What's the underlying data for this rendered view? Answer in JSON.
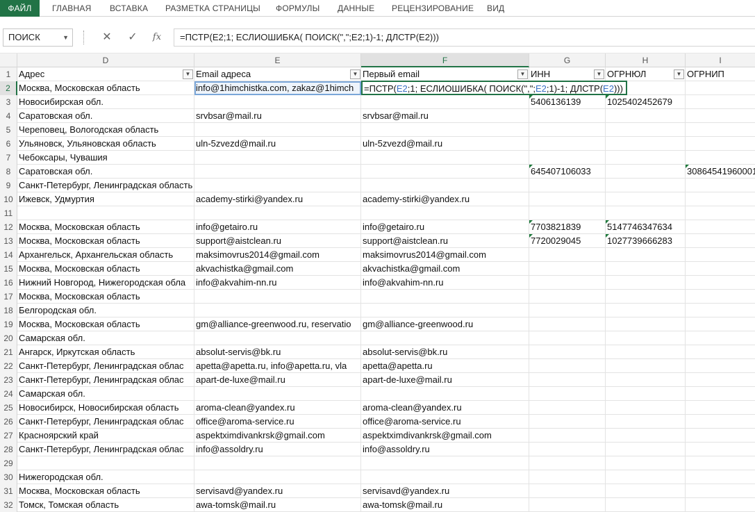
{
  "ribbon": {
    "tabs": [
      "ФАЙЛ",
      "ГЛАВНАЯ",
      "ВСТАВКА",
      "РАЗМЕТКА СТРАНИЦЫ",
      "ФОРМУЛЫ",
      "ДАННЫЕ",
      "РЕЦЕНЗИРОВАНИЕ",
      "ВИД"
    ]
  },
  "formula_bar": {
    "name_box": "ПОИСК",
    "cancel_icon": "✕",
    "enter_icon": "✓",
    "fx_label": "fx",
    "formula": "=ПСТР(E2;1; ЕСЛИОШИБКА( ПОИСК(\",\";E2;1)-1; ДЛСТР(E2)))"
  },
  "columns": [
    "D",
    "E",
    "F",
    "G",
    "H",
    "I"
  ],
  "header_row": {
    "row": "1",
    "d": "Адрес",
    "e": "Email адреса",
    "f": "Первый email",
    "g": "ИНН",
    "h": "ОГРНЮЛ",
    "i": "ОГРНИП"
  },
  "edit_cell": {
    "p1": "=ПСТР(",
    "r1": "E2",
    "p2": ";1; ЕСЛИОШИБКА( ПОИСК(\",\";",
    "r2": "E2",
    "p3": ";1)-1; ДЛСТР(",
    "r3": "E2",
    "p4": ")))"
  },
  "rows": [
    {
      "n": "2",
      "d": "Москва, Московская область",
      "e": "info@1himchistka.com, zakaz@1himch",
      "f": "",
      "g": "",
      "h": "",
      "i": ""
    },
    {
      "n": "3",
      "d": "Новосибирская обл.",
      "e": "",
      "f": "",
      "g": "5406136139",
      "h": "1025402452679",
      "i": ""
    },
    {
      "n": "4",
      "d": "Саратовская обл.",
      "e": "srvbsar@mail.ru",
      "f": "srvbsar@mail.ru",
      "g": "",
      "h": "",
      "i": ""
    },
    {
      "n": "5",
      "d": "Череповец, Вологодская область",
      "e": "",
      "f": "",
      "g": "",
      "h": "",
      "i": ""
    },
    {
      "n": "6",
      "d": "Ульяновск, Ульяновская область",
      "e": "uln-5zvezd@mail.ru",
      "f": "uln-5zvezd@mail.ru",
      "g": "",
      "h": "",
      "i": ""
    },
    {
      "n": "7",
      "d": "Чебоксары, Чувашия",
      "e": "",
      "f": "",
      "g": "",
      "h": "",
      "i": ""
    },
    {
      "n": "8",
      "d": "Саратовская обл.",
      "e": "",
      "f": "",
      "g": "645407106033",
      "h": "",
      "i": "30864541960001"
    },
    {
      "n": "9",
      "d": "Санкт-Петербург, Ленинградская область",
      "e": "",
      "f": "",
      "g": "",
      "h": "",
      "i": ""
    },
    {
      "n": "10",
      "d": "Ижевск, Удмуртия",
      "e": "academy-stirki@yandex.ru",
      "f": "academy-stirki@yandex.ru",
      "g": "",
      "h": "",
      "i": ""
    },
    {
      "n": "11",
      "d": "",
      "e": "",
      "f": "",
      "g": "",
      "h": "",
      "i": ""
    },
    {
      "n": "12",
      "d": "Москва, Московская область",
      "e": "info@getairo.ru",
      "f": "info@getairo.ru",
      "g": "7703821839",
      "h": "5147746347634",
      "i": ""
    },
    {
      "n": "13",
      "d": "Москва, Московская область",
      "e": "support@aistclean.ru",
      "f": "support@aistclean.ru",
      "g": "7720029045",
      "h": "1027739666283",
      "i": ""
    },
    {
      "n": "14",
      "d": "Архангельск, Архангельская область",
      "e": "maksimovrus2014@gmail.com",
      "f": "maksimovrus2014@gmail.com",
      "g": "",
      "h": "",
      "i": ""
    },
    {
      "n": "15",
      "d": "Москва, Московская область",
      "e": "akvachistka@gmail.com",
      "f": "akvachistka@gmail.com",
      "g": "",
      "h": "",
      "i": ""
    },
    {
      "n": "16",
      "d": "Нижний Новгород, Нижегородская обла",
      "e": "info@akvahim-nn.ru",
      "f": "info@akvahim-nn.ru",
      "g": "",
      "h": "",
      "i": ""
    },
    {
      "n": "17",
      "d": "Москва, Московская область",
      "e": "",
      "f": "",
      "g": "",
      "h": "",
      "i": ""
    },
    {
      "n": "18",
      "d": "Белгородская обл.",
      "e": "",
      "f": "",
      "g": "",
      "h": "",
      "i": ""
    },
    {
      "n": "19",
      "d": "Москва, Московская область",
      "e": "gm@alliance-greenwood.ru, reservatio",
      "f": "gm@alliance-greenwood.ru",
      "g": "",
      "h": "",
      "i": ""
    },
    {
      "n": "20",
      "d": "Самарская обл.",
      "e": "",
      "f": "",
      "g": "",
      "h": "",
      "i": ""
    },
    {
      "n": "21",
      "d": "Ангарск, Иркутская область",
      "e": "absolut-servis@bk.ru",
      "f": "absolut-servis@bk.ru",
      "g": "",
      "h": "",
      "i": ""
    },
    {
      "n": "22",
      "d": "Санкт-Петербург, Ленинградская облас",
      "e": "apetta@apetta.ru, info@apetta.ru, vla",
      "f": "apetta@apetta.ru",
      "g": "",
      "h": "",
      "i": ""
    },
    {
      "n": "23",
      "d": "Санкт-Петербург, Ленинградская облас",
      "e": "apart-de-luxe@mail.ru",
      "f": "apart-de-luxe@mail.ru",
      "g": "",
      "h": "",
      "i": ""
    },
    {
      "n": "24",
      "d": "Самарская обл.",
      "e": "",
      "f": "",
      "g": "",
      "h": "",
      "i": ""
    },
    {
      "n": "25",
      "d": "Новосибирск, Новосибирская область",
      "e": "aroma-clean@yandex.ru",
      "f": "aroma-clean@yandex.ru",
      "g": "",
      "h": "",
      "i": ""
    },
    {
      "n": "26",
      "d": "Санкт-Петербург, Ленинградская облас",
      "e": "office@aroma-service.ru",
      "f": "office@aroma-service.ru",
      "g": "",
      "h": "",
      "i": ""
    },
    {
      "n": "27",
      "d": "Красноярский край",
      "e": "aspektximdivankrsk@gmail.com",
      "f": "aspektximdivankrsk@gmail.com",
      "g": "",
      "h": "",
      "i": ""
    },
    {
      "n": "28",
      "d": "Санкт-Петербург, Ленинградская облас",
      "e": "info@assoldry.ru",
      "f": "info@assoldry.ru",
      "g": "",
      "h": "",
      "i": ""
    },
    {
      "n": "29",
      "d": "",
      "e": "",
      "f": "",
      "g": "",
      "h": "",
      "i": ""
    },
    {
      "n": "30",
      "d": "Нижегородская обл.",
      "e": "",
      "f": "",
      "g": "",
      "h": "",
      "i": ""
    },
    {
      "n": "31",
      "d": "Москва, Московская область",
      "e": "servisavd@yandex.ru",
      "f": "servisavd@yandex.ru",
      "g": "",
      "h": "",
      "i": ""
    },
    {
      "n": "32",
      "d": "Томск, Томская область",
      "e": "awa-tomsk@mail.ru",
      "f": "awa-tomsk@mail.ru",
      "g": "",
      "h": "",
      "i": ""
    }
  ]
}
